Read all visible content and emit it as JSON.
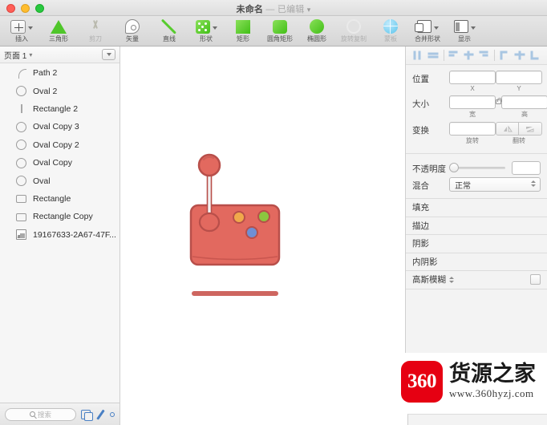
{
  "window": {
    "title": "未命名",
    "separator": "—",
    "edited_badge": "已编辑",
    "title_chevron": "chevron-down-icon"
  },
  "toolbar": {
    "items": [
      {
        "label": "插入",
        "icon": "insert-plus-icon",
        "dimmed": false,
        "has_caret": true
      },
      {
        "label": "三角形",
        "icon": "triangle-icon",
        "dimmed": false,
        "has_caret": false
      },
      {
        "label": "剪刀",
        "icon": "scissors-icon",
        "dimmed": true,
        "has_caret": false
      },
      {
        "label": "矢量",
        "icon": "vector-pen-icon",
        "dimmed": false,
        "has_caret": false
      },
      {
        "label": "直线",
        "icon": "line-icon",
        "dimmed": false,
        "has_caret": false
      },
      {
        "label": "形状",
        "icon": "shapes-icon",
        "dimmed": false,
        "has_caret": true
      },
      {
        "label": "矩形",
        "icon": "rectangle-icon",
        "dimmed": false,
        "has_caret": false
      },
      {
        "label": "圆角矩形",
        "icon": "rounded-rectangle-icon",
        "dimmed": false,
        "has_caret": false
      },
      {
        "label": "椭圆形",
        "icon": "ellipse-icon",
        "dimmed": false,
        "has_caret": false
      },
      {
        "label": "旋转复制",
        "icon": "rotate-copy-icon",
        "dimmed": true,
        "has_caret": false
      },
      {
        "label": "蒙板",
        "icon": "mask-icon",
        "dimmed": true,
        "has_caret": false
      },
      {
        "label": "合并形状",
        "icon": "merge-shapes-icon",
        "dimmed": false,
        "has_caret": true
      },
      {
        "label": "显示",
        "icon": "display-icon",
        "dimmed": false,
        "has_caret": true
      }
    ]
  },
  "sidebar": {
    "page_name": "页面 1",
    "page_menu_icon": "page-options-icon",
    "layers": [
      {
        "name": "Path 2",
        "icon": "path-icon"
      },
      {
        "name": "Oval 2",
        "icon": "oval-icon"
      },
      {
        "name": "Rectangle 2",
        "icon": "vertical-line-icon"
      },
      {
        "name": "Oval Copy 3",
        "icon": "oval-icon"
      },
      {
        "name": "Oval Copy 2",
        "icon": "oval-icon"
      },
      {
        "name": "Oval Copy",
        "icon": "oval-icon"
      },
      {
        "name": "Oval",
        "icon": "oval-icon"
      },
      {
        "name": "Rectangle",
        "icon": "rectangle-icon"
      },
      {
        "name": "Rectangle Copy",
        "icon": "rectangle-icon"
      },
      {
        "name": "19167633-2A67-47F...",
        "icon": "image-icon"
      }
    ]
  },
  "bottom_bar": {
    "search_placeholder": "搜索",
    "search_value": "",
    "search_icon": "search-icon",
    "duplicate_icon": "duplicate-icon",
    "pencil_icon": "pencil-icon",
    "ellipse-tool_icon": "small-oval-icon"
  },
  "inspector": {
    "align_buttons": [
      "align-left-icon",
      "align-center-horizontal-icon",
      "align-top-icon",
      "align-middle-icon",
      "align-bottom-icon",
      "distribute-left-icon",
      "distribute-center-icon",
      "distribute-right-icon"
    ],
    "position": {
      "label": "位置",
      "x_value": "",
      "x_sublabel": "X",
      "y_value": "",
      "y_sublabel": "Y"
    },
    "size": {
      "label": "大小",
      "w_value": "",
      "w_sublabel": "宽",
      "h_value": "",
      "h_sublabel": "高",
      "lock_icon": "lock-aspect-ratio-icon"
    },
    "transform": {
      "label": "变换",
      "rotate_value": "",
      "rotate_sublabel": "旋转",
      "flip_sublabel": "翻转",
      "flip_h_icon": "flip-horizontal-icon",
      "flip_v_icon": "flip-vertical-icon"
    },
    "opacity": {
      "label": "不透明度",
      "value": "",
      "slider_percent": 0
    },
    "blend": {
      "label": "混合",
      "selected": "正常"
    },
    "sections": [
      {
        "label": "填充"
      },
      {
        "label": "描边"
      },
      {
        "label": "阴影"
      },
      {
        "label": "内阴影"
      }
    ],
    "blur": {
      "label": "高斯模糊",
      "chevron_icon": "updown-chevron-icon",
      "checkbox_checked": false
    }
  },
  "canvas": {
    "artwork_name": "joystick-illustration",
    "colors": {
      "body_fill": "#e2695f",
      "body_stroke": "#b84f4a",
      "knob_fill": "#e2695f",
      "stick_fill": "#f2f2f2",
      "button_orange": "#f0a94b",
      "button_green": "#8cc63f",
      "button_blue": "#6f8fd4"
    },
    "buttons": [
      {
        "name": "button-orange",
        "color": "#f0a94b"
      },
      {
        "name": "button-green",
        "color": "#8cc63f"
      },
      {
        "name": "button-blue",
        "color": "#6f8fd4"
      }
    ]
  },
  "watermark": {
    "logo_text": "360",
    "brand_cn": "货源之家",
    "url": "www.360hyzj.com",
    "logo_color": "#e60012"
  }
}
